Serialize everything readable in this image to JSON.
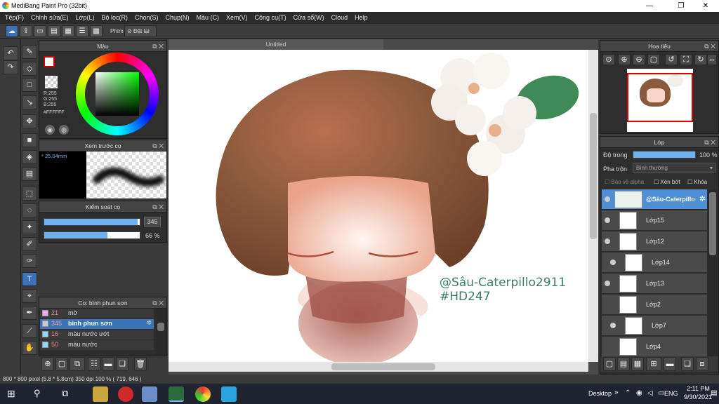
{
  "window": {
    "title": "MediBang Paint Pro (32bit)",
    "min": "—",
    "max": "❐",
    "close": "✕"
  },
  "menu": [
    "Tệp(F)",
    "Chỉnh sửa(E)",
    "Lớp(L)",
    "Bộ lọc(R)",
    "Chọn(S)",
    "Chụp(N)",
    "Màu (C)",
    "Xem(V)",
    "Công cụ(T)",
    "Cửa sổ(W)",
    "Cloud",
    "Help"
  ],
  "toolbar": {
    "phim_label": "Phím",
    "reset_label": "Đặt lại"
  },
  "color_panel": {
    "title": "Màu",
    "r": "R:255",
    "g": "G:255",
    "b": "B:255",
    "hex": "#FFFFFF"
  },
  "brush_preview": {
    "title": "Xem trước cọ",
    "size": "* 25.04mm"
  },
  "brush_control": {
    "title": "Kiểm soát cọ",
    "size_value": "345",
    "opacity_value": "66 %",
    "size_fraction": 0.98,
    "opacity_fraction": 0.66
  },
  "brush_list": {
    "title": "Cọ: bình phun sơn",
    "items": [
      {
        "size": "21",
        "name": "mờ",
        "color": "#f7a8f0"
      },
      {
        "size": "345",
        "name": "bình phun sơn",
        "color": "#cccccc",
        "selected": true
      },
      {
        "size": "16",
        "name": "màu nước ướt",
        "color": "#8fd8ff"
      },
      {
        "size": "50",
        "name": "màu nước",
        "color": "#8fd8ff"
      }
    ]
  },
  "canvas": {
    "tab_title": "Untitled",
    "watermark_line1": "@Sâu-Caterpillo2911",
    "watermark_line2": "#HD247"
  },
  "navigator": {
    "title": "Hoa tiêu"
  },
  "layers": {
    "title": "Lớp",
    "opacity_label": "Độ trong",
    "opacity_value": "100 %",
    "opacity_fraction": 1.0,
    "blend_label": "Pha trộn",
    "blend_value": "Bình thường",
    "alpha_protect": "Bảo vệ alpha",
    "clipping": "Xén bớt",
    "lock": "Khóa",
    "items": [
      {
        "name": "@Sâu-Caterpillo",
        "selected": true
      },
      {
        "name": "Lớp15"
      },
      {
        "name": "Lớp12"
      },
      {
        "name": "Lớp14"
      },
      {
        "name": "Lớp13"
      },
      {
        "name": "Lớp2"
      },
      {
        "name": "Lớp7"
      },
      {
        "name": "Lớp4"
      }
    ]
  },
  "status": {
    "text": "800 * 800 pixel   (5.8 * 5.8cm)   350 dpi   100 %   ( 719, 646 )"
  },
  "taskbar": {
    "desktop": "Desktop",
    "lang": "ENG",
    "time": "2:11 PM",
    "date": "9/30/2021"
  },
  "colors": {
    "accent": "#3b73b9",
    "hair": "#8b5a3c",
    "dress": "#a0544a",
    "leaf": "#3f8a55",
    "watermark": "#3c7c68"
  }
}
